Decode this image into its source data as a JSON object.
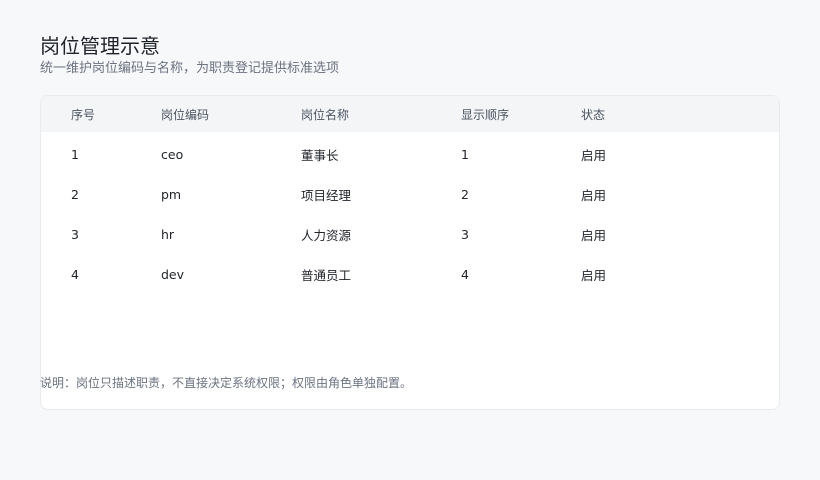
{
  "header": {
    "title": "岗位管理示意",
    "subtitle": "统一维护岗位编码与名称，为职责登记提供标准选项"
  },
  "table": {
    "columns": [
      "序号",
      "岗位编码",
      "岗位名称",
      "显示顺序",
      "状态"
    ],
    "rows": [
      [
        "1",
        "ceo",
        "董事长",
        "1",
        "启用"
      ],
      [
        "2",
        "pm",
        "项目经理",
        "2",
        "启用"
      ],
      [
        "3",
        "hr",
        "人力资源",
        "3",
        "启用"
      ],
      [
        "4",
        "dev",
        "普通员工",
        "4",
        "启用"
      ]
    ]
  },
  "footer": {
    "note": "说明：岗位只描述职责，不直接决定系统权限；权限由角色单独配置。"
  }
}
